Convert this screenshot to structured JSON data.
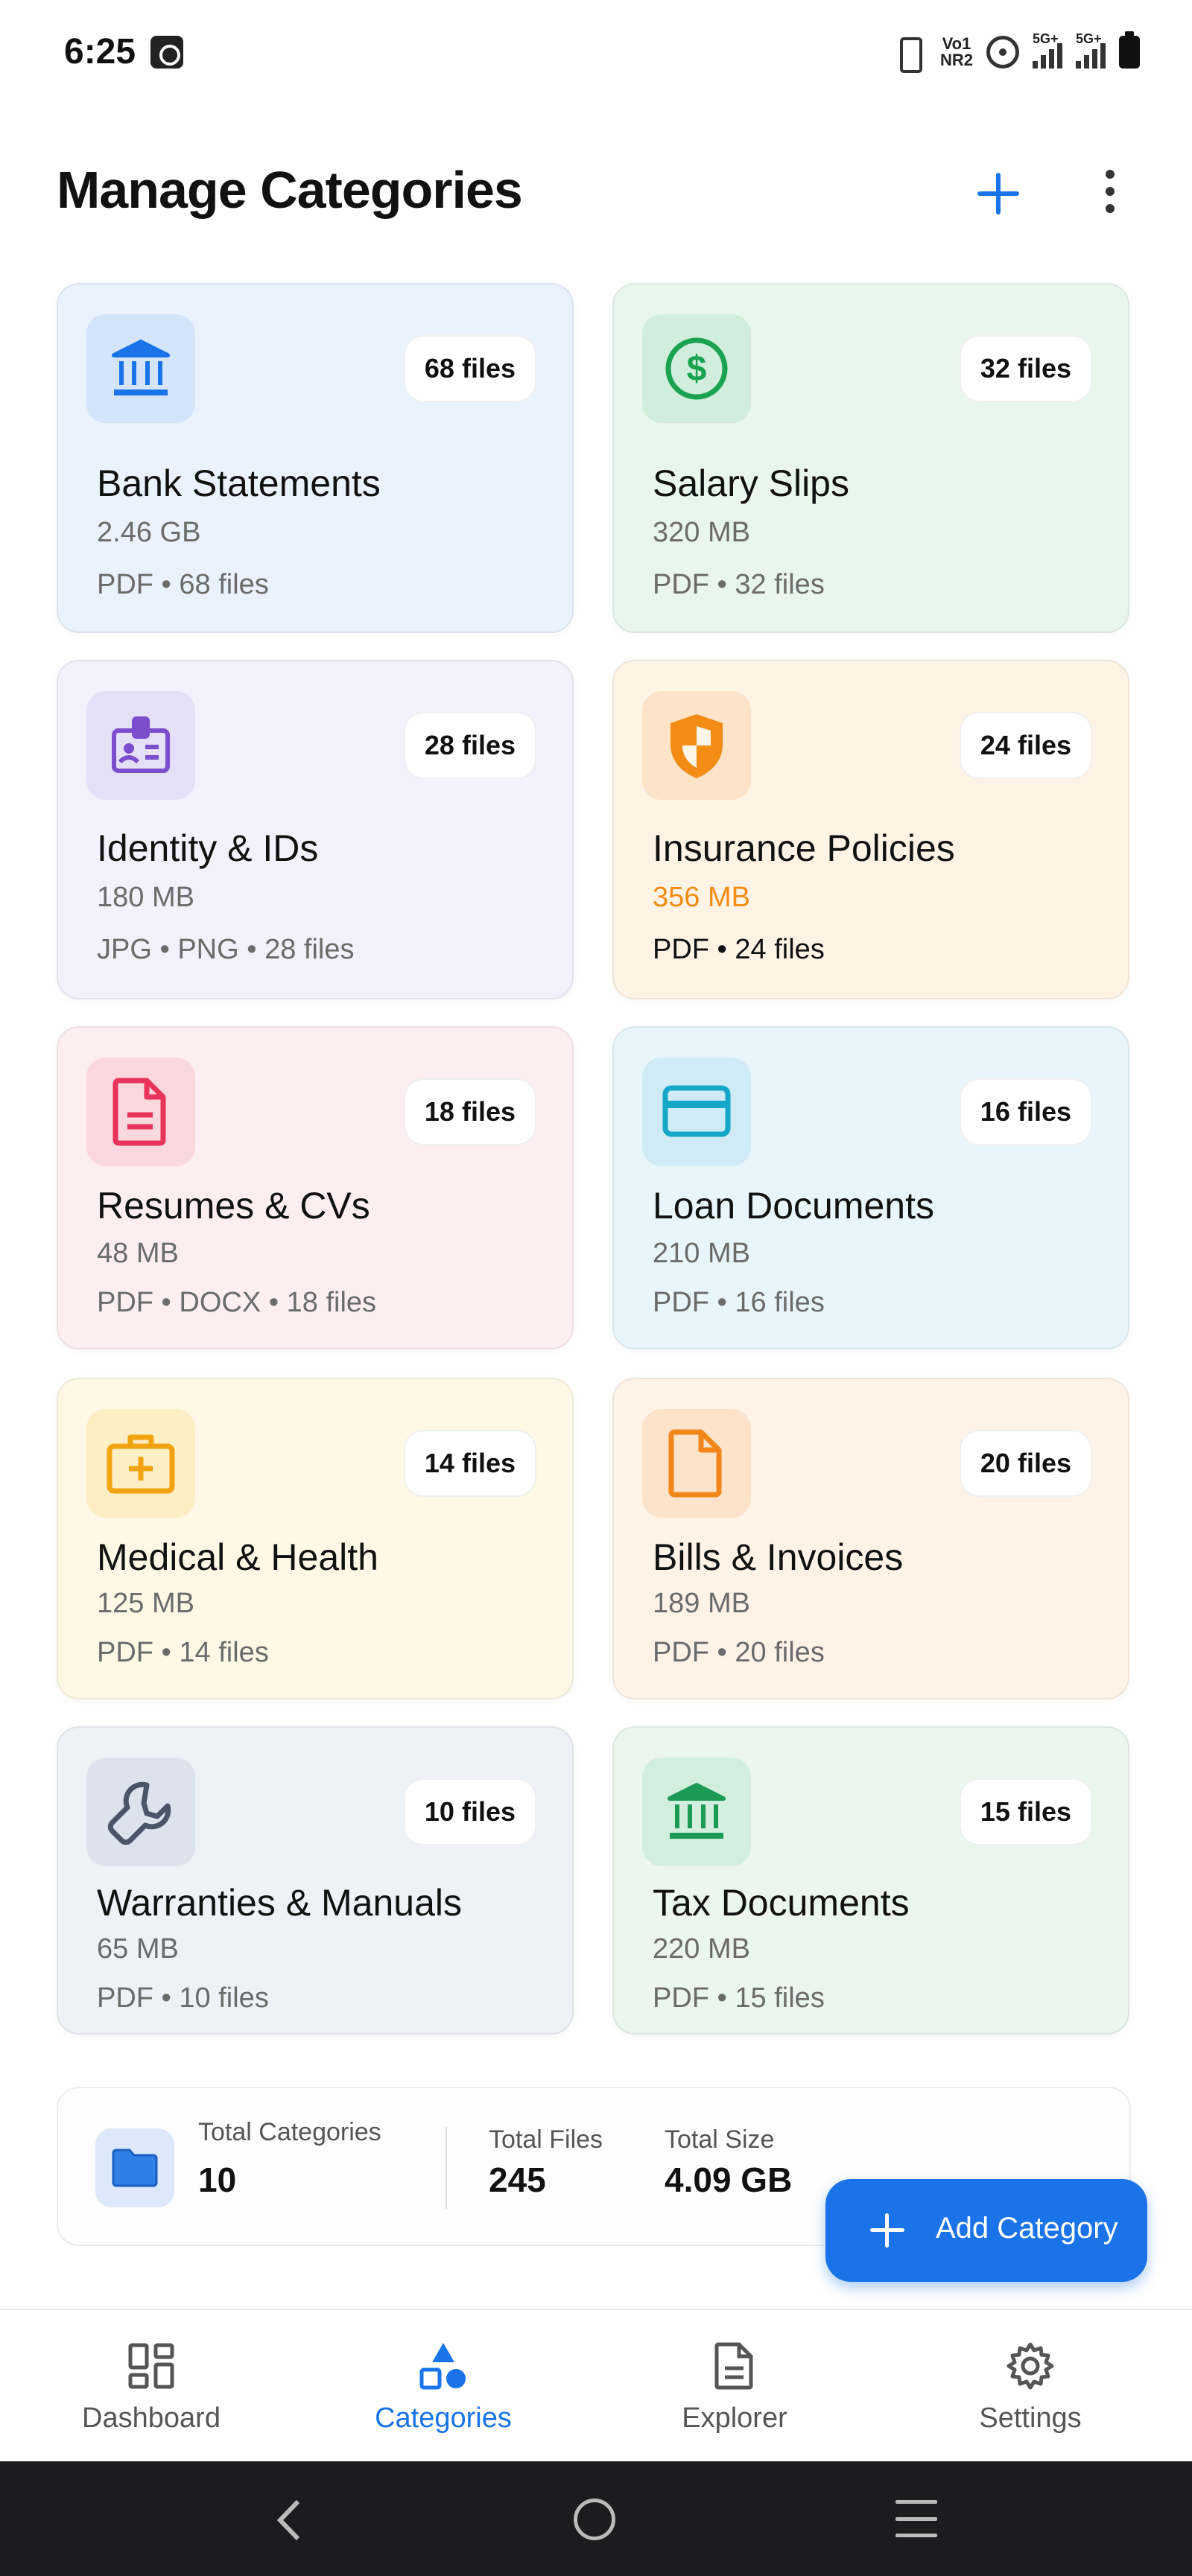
{
  "status_bar": {
    "time": "6:25",
    "volte_label": "Vo1\nNR2",
    "signal1_label": "5G+",
    "signal2_label": "5G+"
  },
  "header": {
    "title": "Manage Categories"
  },
  "categories": [
    {
      "name": "Bank Statements",
      "size": "2.46 GB",
      "meta": "PDF • 68 files",
      "badge": "68 files",
      "icon": "bank-icon",
      "bg": "#eaf2fd",
      "icon_bg": "#d4e5fb",
      "icon_color": "#1a73e8"
    },
    {
      "name": "Salary Slips",
      "size": "320 MB",
      "meta": "PDF • 32 files",
      "badge": "32 files",
      "icon": "dollar-icon",
      "bg": "#e9f6ee",
      "icon_bg": "#d0eedb",
      "icon_color": "#1aa251"
    },
    {
      "name": "Identity & IDs",
      "size": "180 MB",
      "meta": "JPG • PNG • 28 files",
      "badge": "28 files",
      "icon": "id-badge-icon",
      "bg": "#f2f1fc",
      "icon_bg": "#e4e0f7",
      "icon_color": "#7c4dcc"
    },
    {
      "name": "Insurance Policies",
      "size": "356 MB",
      "meta": "PDF • 24 files",
      "badge": "24 files",
      "icon": "shield-icon",
      "bg": "#fff3e6",
      "icon_bg": "#fde3c7",
      "icon_color": "#f28c14",
      "size_color": "#f28c14",
      "meta_color": "#111111"
    },
    {
      "name": "Resumes & CVs",
      "size": "48 MB",
      "meta": "PDF • DOCX • 18 files",
      "badge": "18 files",
      "icon": "document-icon",
      "bg": "#fdeef1",
      "icon_bg": "#fad8de",
      "icon_color": "#e8335a"
    },
    {
      "name": "Loan Documents",
      "size": "210 MB",
      "meta": "PDF • 16 files",
      "badge": "16 files",
      "icon": "credit-card-icon",
      "bg": "#e8f6fb",
      "icon_bg": "#cfecf6",
      "icon_color": "#15a6c8"
    },
    {
      "name": "Medical & Health",
      "size": "125 MB",
      "meta": "PDF • 14 files",
      "badge": "14 files",
      "icon": "medical-kit-icon",
      "bg": "#fff8e6",
      "icon_bg": "#fdeec4",
      "icon_color": "#f2a312"
    },
    {
      "name": "Bills & Invoices",
      "size": "189 MB",
      "meta": "PDF • 20 files",
      "badge": "20 files",
      "icon": "file-icon",
      "bg": "#fff3e8",
      "icon_bg": "#fde3c9",
      "icon_color": "#f2861a"
    },
    {
      "name": "Warranties & Manuals",
      "size": "65 MB",
      "meta": "PDF • 10 files",
      "badge": "10 files",
      "icon": "wrench-icon",
      "bg": "#eef1f6",
      "icon_bg": "#dde3ec",
      "icon_color": "#4a5568"
    },
    {
      "name": "Tax Documents",
      "size": "220 MB",
      "meta": "PDF • 15 files",
      "badge": "15 files",
      "icon": "bank-icon",
      "bg": "#ebf6ef",
      "icon_bg": "#d2eedc",
      "icon_color": "#1a9a55"
    }
  ],
  "summary": {
    "categories_label": "Total Categories",
    "categories_value": "10",
    "files_label": "Total Files",
    "files_value": "245",
    "size_label": "Total Size",
    "size_value": "4.09 GB"
  },
  "fab": {
    "label": "Add Category"
  },
  "nav": [
    {
      "label": "Dashboard",
      "icon": "dashboard-icon",
      "active": false
    },
    {
      "label": "Categories",
      "icon": "categories-icon",
      "active": true
    },
    {
      "label": "Explorer",
      "icon": "explorer-icon",
      "active": false
    },
    {
      "label": "Settings",
      "icon": "gear-icon",
      "active": false
    }
  ],
  "colors": {
    "accent": "#1a73e8",
    "text_primary": "#111111",
    "text_secondary": "#6b6b6b"
  }
}
